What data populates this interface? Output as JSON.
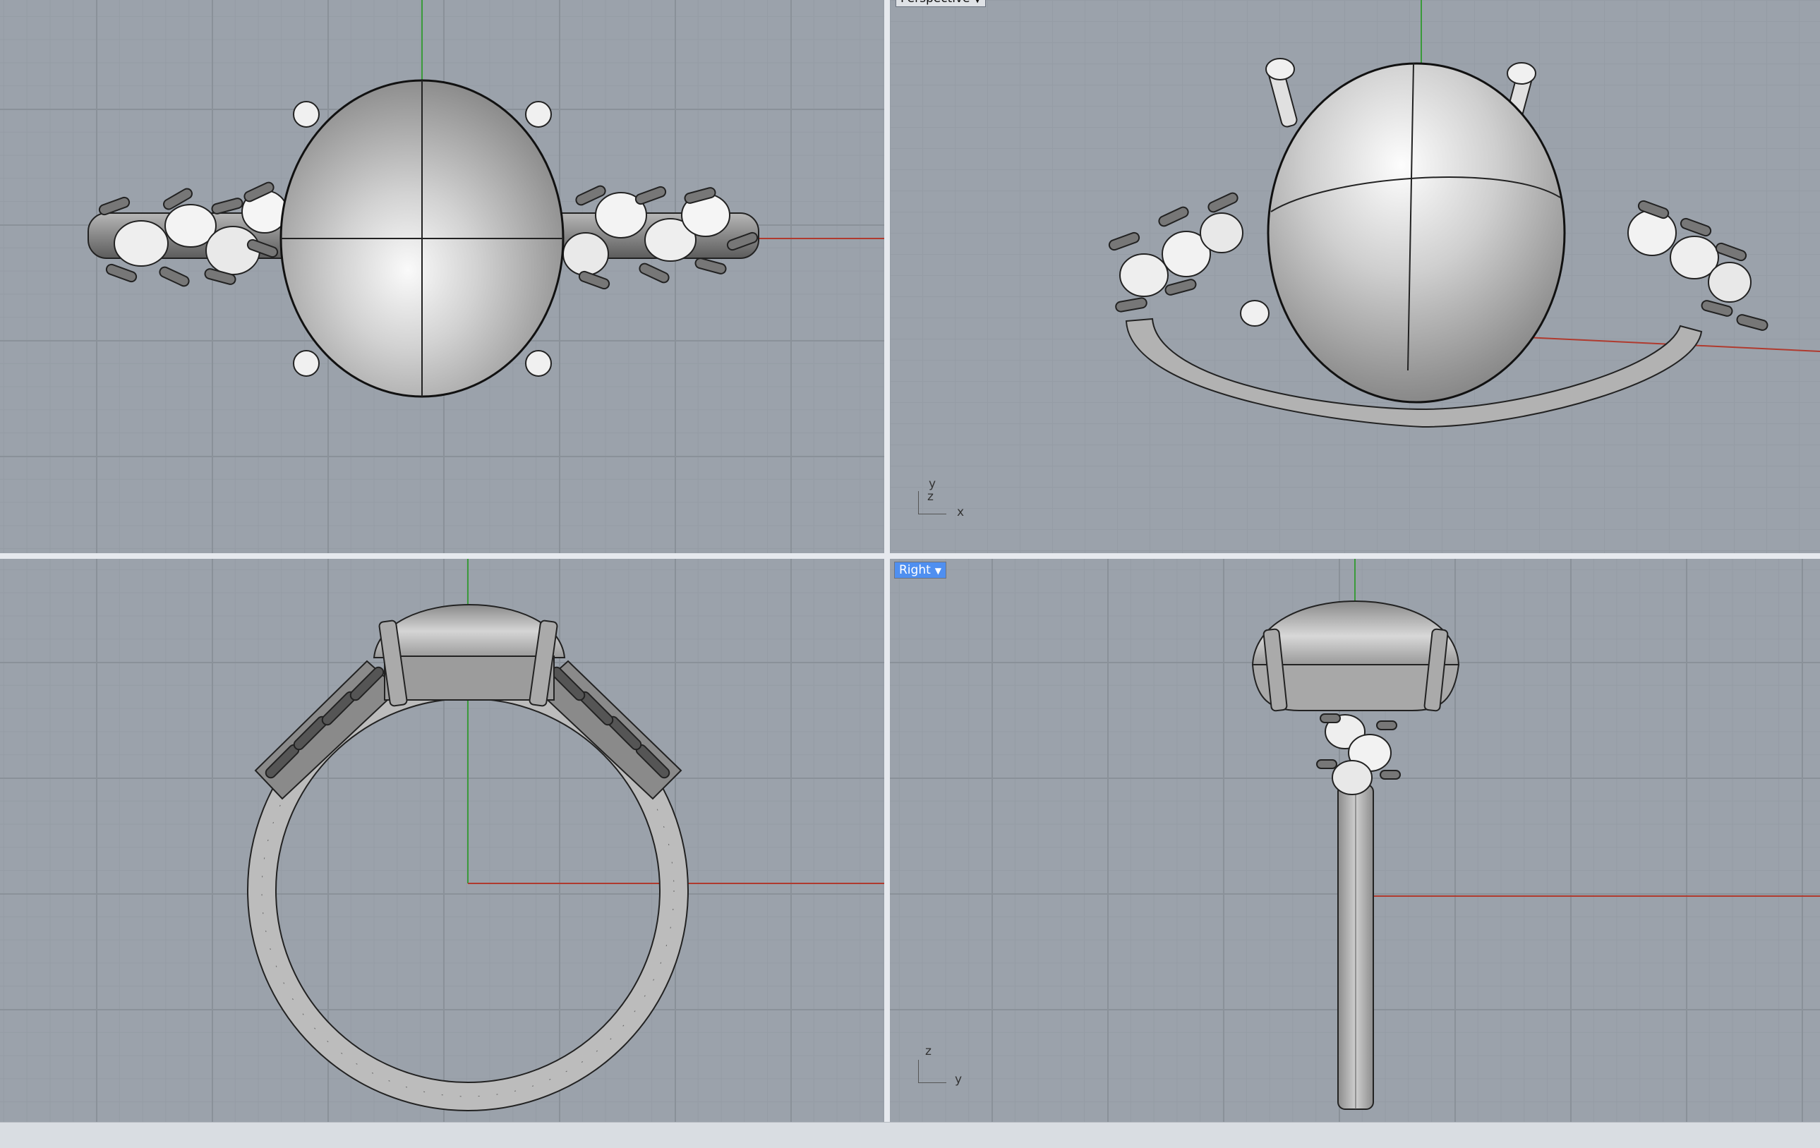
{
  "viewports": {
    "top": {
      "label": ""
    },
    "perspective": {
      "label": "Perspective",
      "axes": {
        "a": "y",
        "b": "z",
        "c": "x"
      }
    },
    "front": {
      "label": ""
    },
    "right": {
      "label": "Right",
      "axes": {
        "a": "z",
        "b": "y"
      }
    }
  },
  "colors": {
    "viewport_bg": "#9ba2ab",
    "grid": "#8a9199",
    "x_axis": "#b03a2e",
    "y_axis": "#3a9a3a",
    "active_tab": "#4f8ff0",
    "model": "#c9c9c9"
  },
  "icons": {
    "dropdown": "chevron-down-icon"
  }
}
